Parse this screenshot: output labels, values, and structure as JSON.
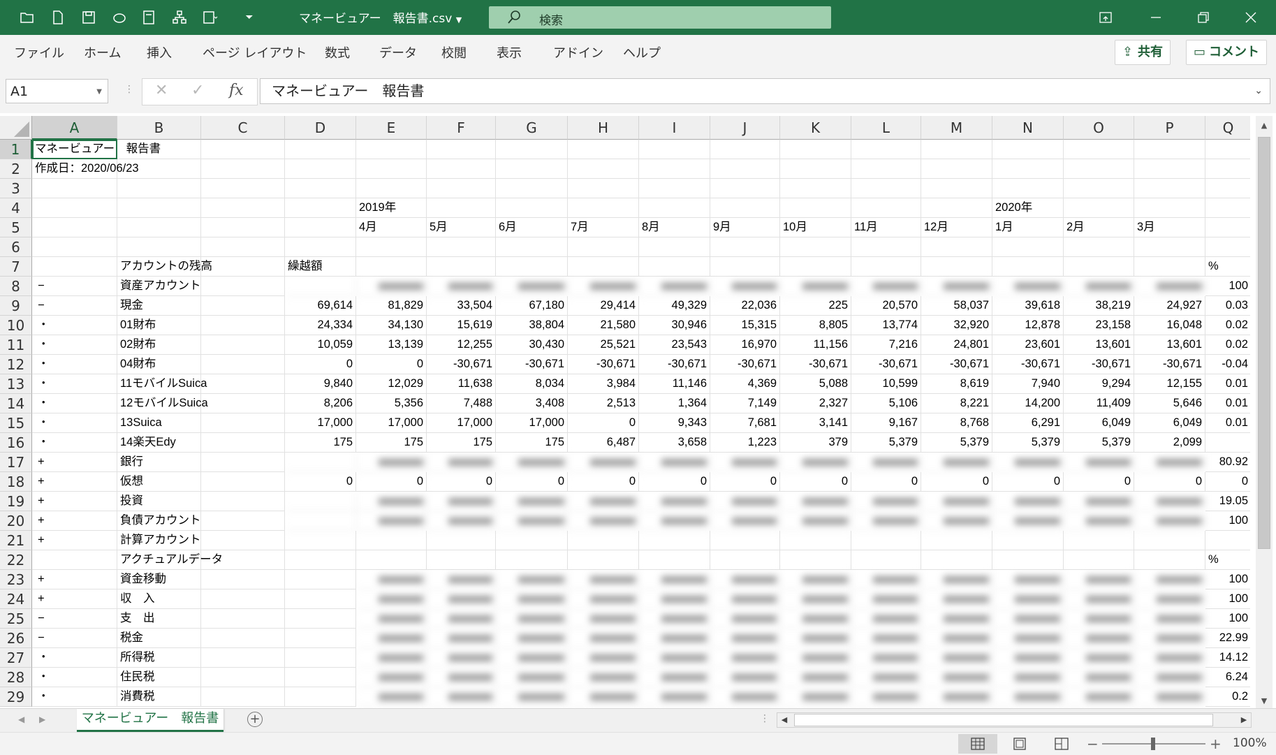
{
  "titlebar": {
    "doc_title": "マネービュアー　報告書.csv",
    "search_label": "検索",
    "accent_color": "#217346"
  },
  "ribbon": {
    "tabs": [
      "ファイル",
      "ホーム",
      "挿入",
      "ページ レイアウト",
      "数式",
      "データ",
      "校閲",
      "表示",
      "アドイン",
      "ヘルプ"
    ],
    "share_label": "共有",
    "comment_label": "コメント"
  },
  "formula_bar": {
    "name_box": "A1",
    "formula": "マネービュアー　報告書"
  },
  "columns": [
    "A",
    "B",
    "C",
    "D",
    "E",
    "F",
    "G",
    "H",
    "I",
    "J",
    "K",
    "L",
    "M",
    "N",
    "O",
    "P",
    "Q"
  ],
  "rows": [
    {
      "n": "1",
      "a": "マネービュアー　報告書",
      "b": "",
      "c": "",
      "d": "",
      "m": [],
      "q": ""
    },
    {
      "n": "2",
      "a": "作成日：2020/06/23",
      "b": "",
      "c": "",
      "d": "",
      "m": [],
      "q": ""
    },
    {
      "n": "3",
      "a": "",
      "b": "",
      "c": "",
      "d": "",
      "m": [],
      "q": ""
    },
    {
      "n": "4",
      "a": "",
      "b": "",
      "c": "",
      "d": "",
      "m": [
        "2019年",
        "",
        "",
        "",
        "",
        "",
        "",
        "",
        "",
        "2020年",
        "",
        ""
      ],
      "q": ""
    },
    {
      "n": "5",
      "a": "",
      "b": "",
      "c": "",
      "d": "",
      "m": [
        "4月",
        "5月",
        "6月",
        "7月",
        "8月",
        "9月",
        "10月",
        "11月",
        "12月",
        "1月",
        "2月",
        "3月"
      ],
      "q": ""
    },
    {
      "n": "6",
      "a": "",
      "b": "",
      "c": "",
      "d": "",
      "m": [],
      "q": ""
    },
    {
      "n": "7",
      "a": "",
      "b": "アカウントの残高",
      "c": "",
      "d": "繰越額",
      "m": [],
      "q": "%"
    },
    {
      "n": "8",
      "a": "−",
      "b": "資産アカウント",
      "c": "",
      "d": "",
      "blur": true,
      "m": [],
      "q": "100"
    },
    {
      "n": "9",
      "a": "−",
      "b": "現金",
      "c": "",
      "d": "69,614",
      "m": [
        "81,829",
        "33,504",
        "67,180",
        "29,414",
        "49,329",
        "22,036",
        "225",
        "20,570",
        "58,037",
        "39,618",
        "38,219",
        "24,927"
      ],
      "q": "0.03"
    },
    {
      "n": "10",
      "a": "・",
      "b": "01財布",
      "c": "",
      "d": "24,334",
      "m": [
        "34,130",
        "15,619",
        "38,804",
        "21,580",
        "30,946",
        "15,315",
        "8,805",
        "13,774",
        "32,920",
        "12,878",
        "23,158",
        "16,048"
      ],
      "q": "0.02"
    },
    {
      "n": "11",
      "a": "・",
      "b": "02財布",
      "c": "",
      "d": "10,059",
      "m": [
        "13,139",
        "12,255",
        "30,430",
        "25,521",
        "23,543",
        "16,970",
        "11,156",
        "7,216",
        "24,801",
        "23,601",
        "13,601",
        "13,601"
      ],
      "q": "0.02"
    },
    {
      "n": "12",
      "a": "・",
      "b": "04財布",
      "c": "",
      "d": "0",
      "m": [
        "0",
        "-30,671",
        "-30,671",
        "-30,671",
        "-30,671",
        "-30,671",
        "-30,671",
        "-30,671",
        "-30,671",
        "-30,671",
        "-30,671",
        "-30,671"
      ],
      "q": "-0.04"
    },
    {
      "n": "13",
      "a": "・",
      "b": "11モバイルSuica",
      "c": "",
      "d": "9,840",
      "m": [
        "12,029",
        "11,638",
        "8,034",
        "3,984",
        "11,146",
        "4,369",
        "5,088",
        "10,599",
        "8,619",
        "7,940",
        "9,294",
        "12,155"
      ],
      "q": "0.01"
    },
    {
      "n": "14",
      "a": "・",
      "b": "12モバイルSuica",
      "c": "",
      "d": "8,206",
      "m": [
        "5,356",
        "7,488",
        "3,408",
        "2,513",
        "1,364",
        "7,149",
        "2,327",
        "5,106",
        "8,221",
        "14,200",
        "11,409",
        "5,646"
      ],
      "q": "0.01"
    },
    {
      "n": "15",
      "a": "・",
      "b": "13Suica",
      "c": "",
      "d": "17,000",
      "m": [
        "17,000",
        "17,000",
        "17,000",
        "0",
        "9,343",
        "7,681",
        "3,141",
        "9,167",
        "8,768",
        "6,291",
        "6,049",
        "6,049"
      ],
      "q": "0.01"
    },
    {
      "n": "16",
      "a": "・",
      "b": "14楽天Edy",
      "c": "",
      "d": "175",
      "m": [
        "175",
        "175",
        "175",
        "6,487",
        "3,658",
        "1,223",
        "379",
        "5,379",
        "5,379",
        "5,379",
        "5,379",
        "2,099"
      ],
      "q": ""
    },
    {
      "n": "17",
      "a": "+",
      "b": "銀行",
      "c": "",
      "d": "",
      "blur": true,
      "m": [],
      "q": "80.92"
    },
    {
      "n": "18",
      "a": "+",
      "b": "仮想",
      "c": "",
      "d": "0",
      "m": [
        "0",
        "0",
        "0",
        "0",
        "0",
        "0",
        "0",
        "0",
        "0",
        "0",
        "0",
        "0"
      ],
      "q": "0"
    },
    {
      "n": "19",
      "a": "+",
      "b": "投資",
      "c": "",
      "d": "",
      "blur": true,
      "m": [],
      "q": "19.05"
    },
    {
      "n": "20",
      "a": "+",
      "b": "負債アカウント",
      "c": "",
      "d": "",
      "blur": true,
      "m": [],
      "q": "100"
    },
    {
      "n": "21",
      "a": "+",
      "b": "計算アカウント",
      "c": "",
      "d": "",
      "m": [],
      "q": ""
    },
    {
      "n": "22",
      "a": "",
      "b": "アクチュアルデータ",
      "c": "",
      "d": "",
      "m": [],
      "q": "%"
    },
    {
      "n": "23",
      "a": "+",
      "b": "資金移動",
      "c": "",
      "d": "",
      "blur2": true,
      "m": [],
      "q": "100"
    },
    {
      "n": "24",
      "a": "+",
      "b": "収　入",
      "c": "",
      "d": "",
      "blur2": true,
      "m": [],
      "q": "100"
    },
    {
      "n": "25",
      "a": "−",
      "b": "支　出",
      "c": "",
      "d": "",
      "blur2": true,
      "m": [],
      "q": "100"
    },
    {
      "n": "26",
      "a": "−",
      "b": "税金",
      "c": "",
      "d": "",
      "blur2": true,
      "m": [],
      "q": "22.99"
    },
    {
      "n": "27",
      "a": "・",
      "b": "所得税",
      "c": "",
      "d": "",
      "blur2": true,
      "m": [],
      "q": "14.12"
    },
    {
      "n": "28",
      "a": "・",
      "b": "住民税",
      "c": "",
      "d": "",
      "blur2": true,
      "m": [],
      "q": "6.24"
    },
    {
      "n": "29",
      "a": "・",
      "b": "消費税",
      "c": "",
      "d": "",
      "blur2": true,
      "m": [],
      "q": "0.2"
    }
  ],
  "sheet_tabs": [
    "マネービュアー　報告書"
  ],
  "statusbar": {
    "zoom": "100%",
    "zoom_minus": "−",
    "zoom_plus": "+"
  }
}
